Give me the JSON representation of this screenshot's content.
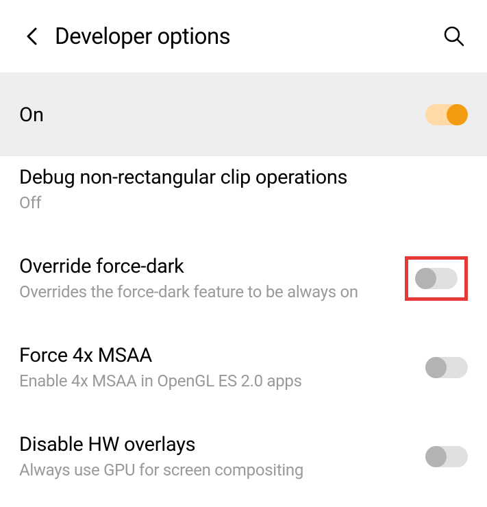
{
  "header": {
    "title": "Developer options"
  },
  "master_toggle": {
    "label": "On"
  },
  "settings": [
    {
      "title": "Debug non-rectangular clip operations",
      "subtitle": "Off"
    },
    {
      "title": "Override force-dark",
      "subtitle": "Overrides the force-dark feature to be always on"
    },
    {
      "title": "Force 4x MSAA",
      "subtitle": "Enable 4x MSAA in OpenGL ES 2.0 apps"
    },
    {
      "title": "Disable HW overlays",
      "subtitle": "Always use GPU for screen compositing"
    }
  ]
}
